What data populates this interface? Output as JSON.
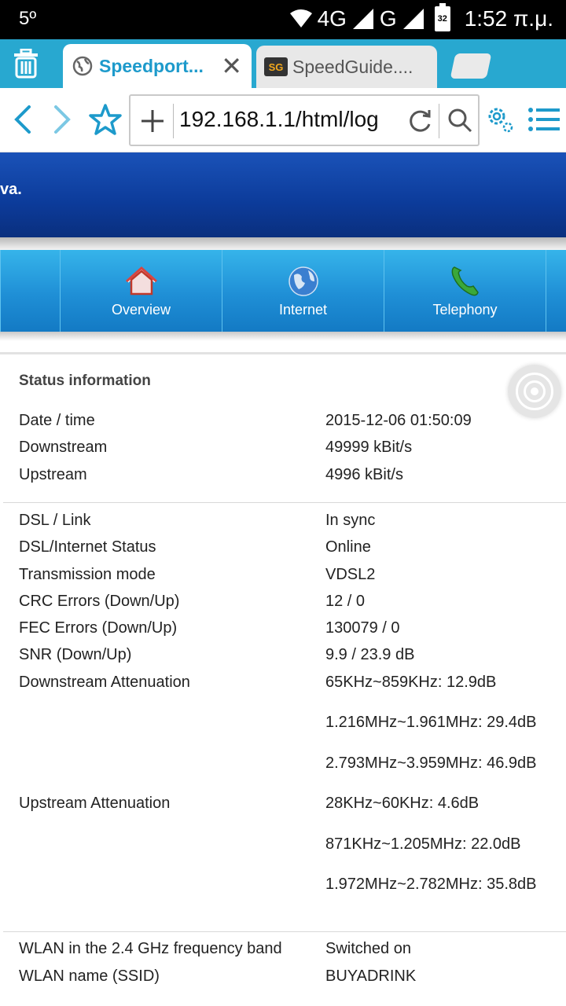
{
  "status_bar": {
    "temperature": "5º",
    "network_4g": "4G",
    "network_g": "G",
    "battery": "32",
    "time": "1:52 π.μ."
  },
  "tabs": [
    {
      "title": "Speedport...",
      "active": true
    },
    {
      "title": "SpeedGuide....",
      "active": false,
      "favicon_text": "SG"
    }
  ],
  "address_bar": {
    "url": "192.168.1.1/html/log"
  },
  "banner": {
    "brand_fragment": "va."
  },
  "nav": [
    {
      "label": "Overview",
      "icon": "house-icon"
    },
    {
      "label": "Internet",
      "icon": "globe-icon"
    },
    {
      "label": "Telephony",
      "icon": "phone-icon"
    }
  ],
  "status_section": {
    "title": "Status information",
    "group1": [
      {
        "key": "Date / time",
        "value": "2015-12-06 01:50:09"
      },
      {
        "key": "Downstream",
        "value": "49999 kBit/s"
      },
      {
        "key": "Upstream",
        "value": "4996 kBit/s"
      }
    ],
    "group2": [
      {
        "key": "DSL / Link",
        "value": "In sync"
      },
      {
        "key": "DSL/Internet Status",
        "value": "Online"
      },
      {
        "key": "Transmission mode",
        "value": "VDSL2"
      },
      {
        "key": "CRC Errors (Down/Up)",
        "value": "12 / 0"
      },
      {
        "key": "FEC Errors (Down/Up)",
        "value": "130079 / 0"
      },
      {
        "key": "SNR (Down/Up)",
        "value": "9.9 / 23.9 dB"
      }
    ],
    "downstream_attenuation": {
      "key": "Downstream Attenuation",
      "values": [
        "65KHz~859KHz: 12.9dB",
        "1.216MHz~1.961MHz: 29.4dB",
        "2.793MHz~3.959MHz: 46.9dB"
      ]
    },
    "upstream_attenuation": {
      "key": "Upstream Attenuation",
      "values": [
        "28KHz~60KHz: 4.6dB",
        "871KHz~1.205MHz: 22.0dB",
        "1.972MHz~2.782MHz: 35.8dB"
      ]
    },
    "group3": [
      {
        "key": "WLAN in the 2.4 GHz frequency band",
        "value": "Switched on"
      },
      {
        "key": "WLAN name (SSID)",
        "value": "BUYADRINK"
      }
    ]
  },
  "colors": {
    "tab_bar": "#28a8d0",
    "nav_blue": "#1f8fd6",
    "banner_blue": "#0c3b9a",
    "accent": "#1d9acb"
  }
}
